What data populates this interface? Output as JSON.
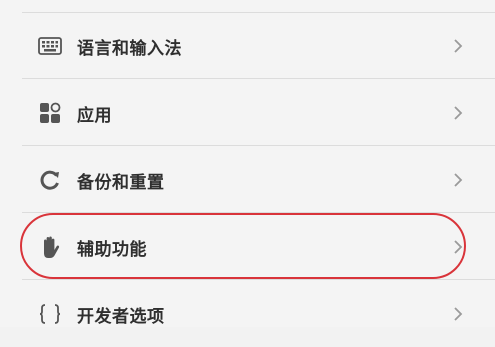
{
  "settings": {
    "items": [
      {
        "label": "语言和输入法",
        "icon": "keyboard-icon"
      },
      {
        "label": "应用",
        "icon": "apps-icon"
      },
      {
        "label": "备份和重置",
        "icon": "backup-reset-icon"
      },
      {
        "label": "辅助功能",
        "icon": "accessibility-hand-icon"
      },
      {
        "label": "开发者选项",
        "icon": "developer-braces-icon"
      }
    ],
    "highlighted_item": "辅助功能",
    "highlight_color": "#d9343a"
  }
}
